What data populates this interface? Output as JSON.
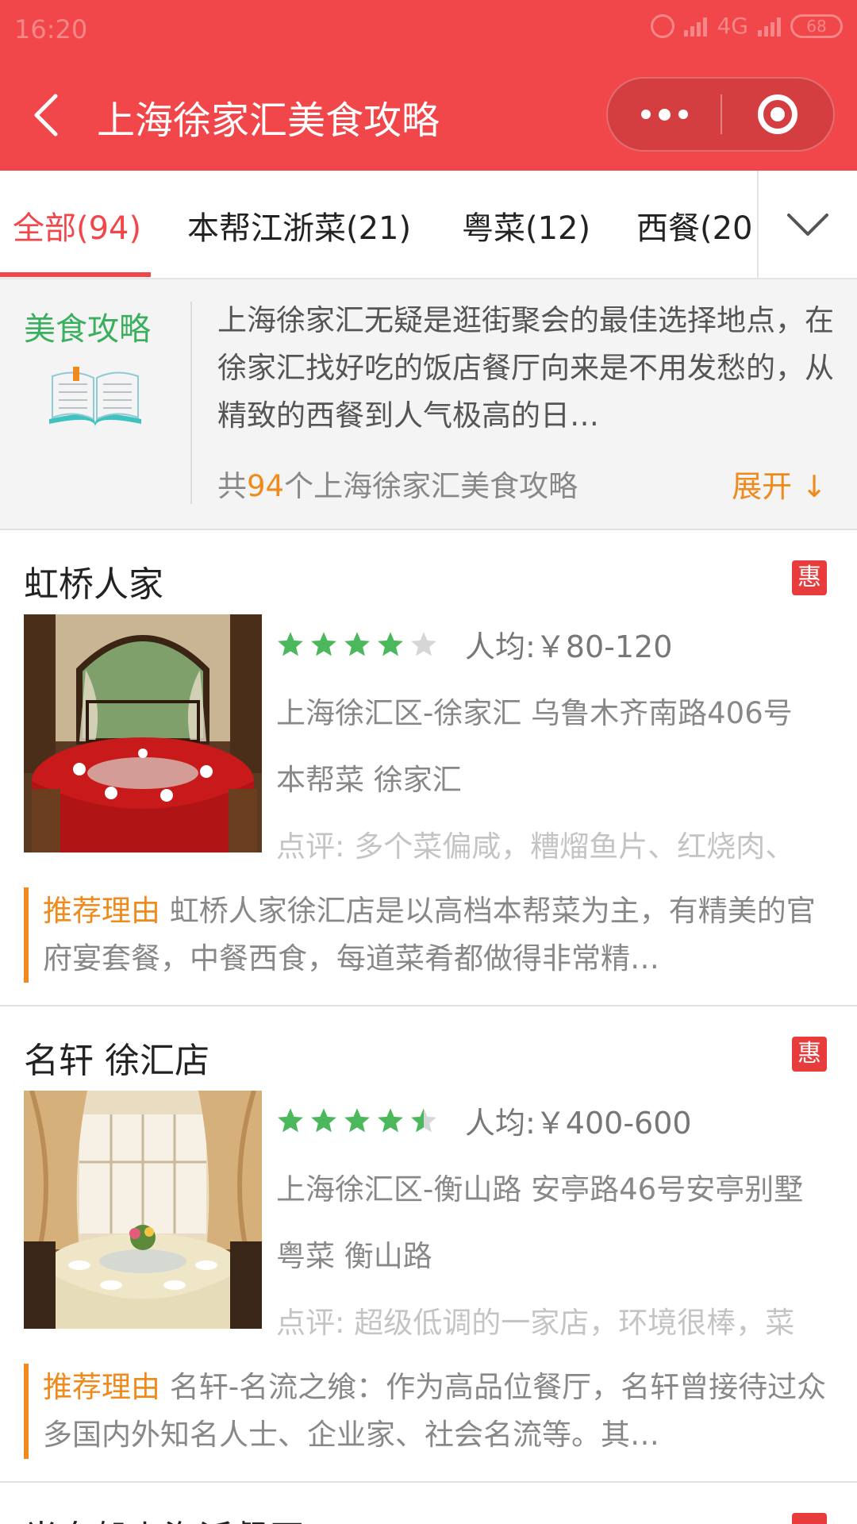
{
  "status_bar": {
    "time": "16:20",
    "network": "4G",
    "battery": "68"
  },
  "nav": {
    "title": "上海徐家汇美食攻略"
  },
  "tabs": [
    {
      "label": "全部(94)",
      "active": true
    },
    {
      "label": "本帮江浙菜(21)",
      "active": false
    },
    {
      "label": "粤菜(12)",
      "active": false
    },
    {
      "label": "西餐(20",
      "active": false
    }
  ],
  "guide": {
    "label": "美食攻略",
    "text": "上海徐家汇无疑是逛街聚会的最佳选择地点，在徐家汇找好吃的饭店餐厅向来是不用发愁的，从精致的西餐到人气极高的日…",
    "count_prefix": "共",
    "count_num": "94",
    "count_suffix": "个上海徐家汇美食攻略",
    "expand": "展开 ↓"
  },
  "restaurants": [
    {
      "name": "虹桥人家",
      "badge": "惠",
      "rating": 4,
      "avg_price": "人均:￥80-120",
      "address": "上海徐汇区-徐家汇 乌鲁木齐南路406号",
      "tags": "本帮菜 徐家汇",
      "review": "点评: 多个菜偏咸，糟熘鱼片、红烧肉、",
      "reason_label": "推荐理由",
      "reason_text": " 虹桥人家徐汇店是以高档本帮菜为主，有精美的官府宴套餐，中餐西食，每道菜肴都做得非常精…"
    },
    {
      "name": "名轩 徐汇店",
      "badge": "惠",
      "rating": 4.5,
      "avg_price": "人均:￥400-600",
      "address": "上海徐汇区-衡山路 安亭路46号安亭别墅",
      "tags": "粤菜 衡山路",
      "review": "点评: 超级低调的一家店，环境很棒，菜",
      "reason_label": "推荐理由",
      "reason_text": " 名轩-名流之飨：作为高品位餐厅，名轩曾接待过众多国内外知名人士、企业家、社会名流等。其…"
    },
    {
      "name": "半岛船上海派餐厅",
      "badge": "惠"
    }
  ],
  "colors": {
    "brand_red": "#f2474a",
    "guide_green": "#3aaf5d",
    "accent_orange": "#f08a1c",
    "star_green": "#4cb85c",
    "star_gray": "#d6d6d6"
  }
}
